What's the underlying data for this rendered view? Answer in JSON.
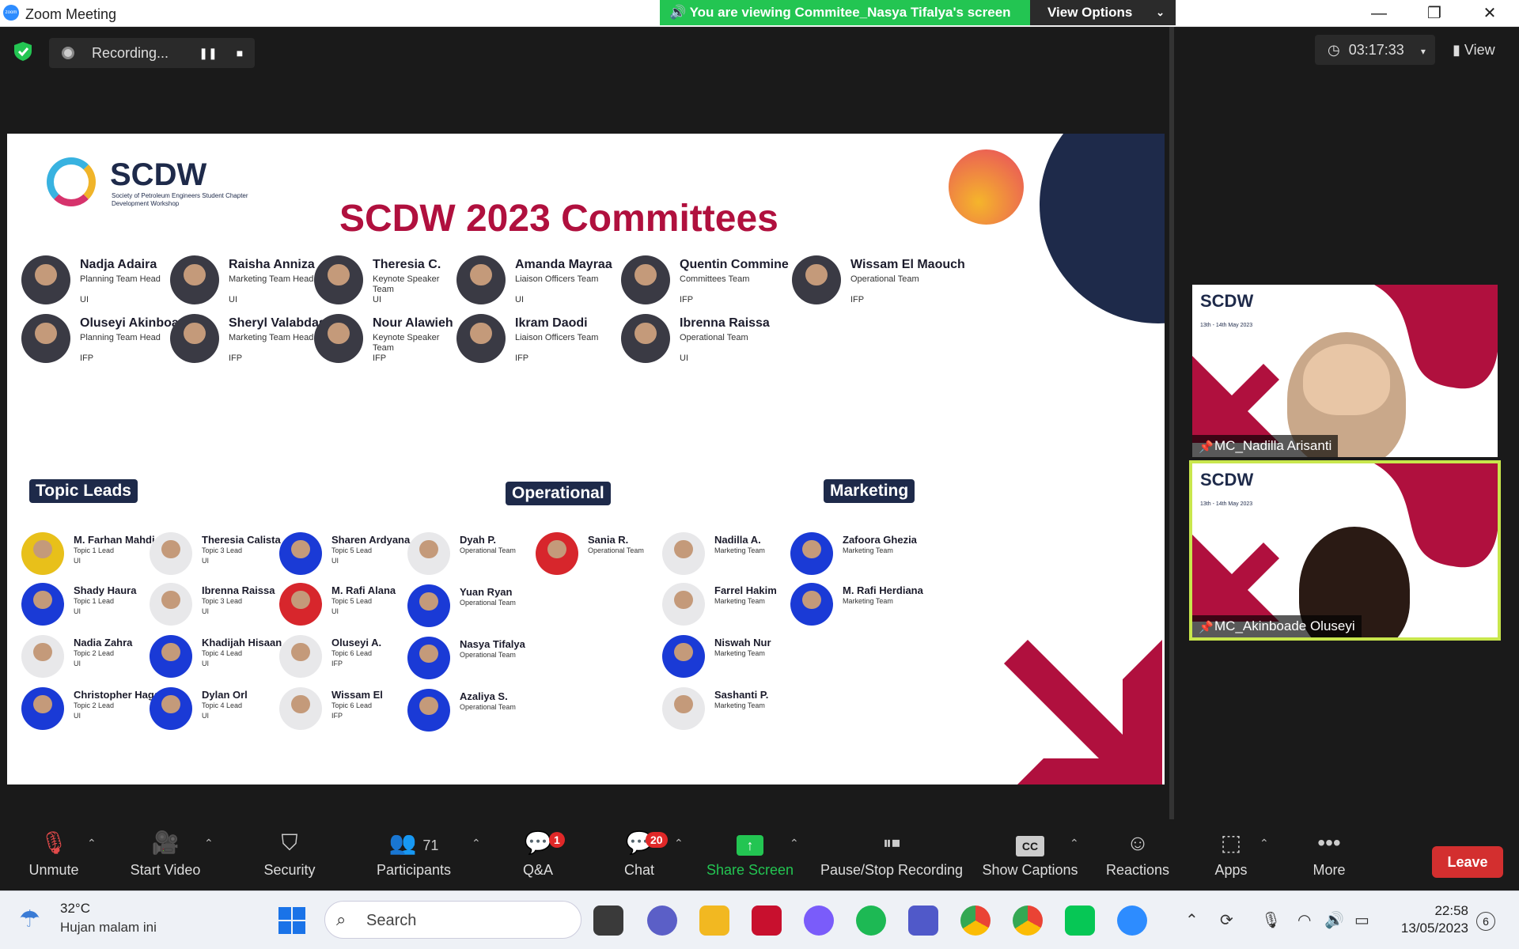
{
  "window": {
    "title": "Zoom Meeting",
    "share_banner": "You are viewing Commitee_Nasya Tifalya's screen",
    "view_options": "View Options",
    "minimize": "—",
    "maximize": "❐",
    "close": "✕"
  },
  "meeting_bar": {
    "recording_label": "Recording...",
    "timer": "03:17:33",
    "view_label": "View"
  },
  "slide": {
    "logo_name": "SCDW",
    "logo_sub": "Society of Petroleum Engineers Student Chapter Development Workshop",
    "title": "SCDW 2023 Committees",
    "heads": [
      {
        "name": "Nadja Adaira",
        "role": "Planning Team Head",
        "org": "UI"
      },
      {
        "name": "Raisha Anniza",
        "role": "Marketing Team Head",
        "org": "UI"
      },
      {
        "name": "Theresia C.",
        "role": "Keynote Speaker Team",
        "org": "UI"
      },
      {
        "name": "Amanda Mayraa",
        "role": "Liaison Officers Team",
        "org": "UI"
      },
      {
        "name": "Quentin Commine",
        "role": "Committees Team",
        "org": "IFP"
      },
      {
        "name": "Wissam El Maouch",
        "role": "Operational Team",
        "org": "IFP"
      },
      {
        "name": "Oluseyi Akinboade",
        "role": "Planning Team Head",
        "org": "IFP"
      },
      {
        "name": "Sheryl Valabdas",
        "role": "Marketing Team Head",
        "org": "IFP"
      },
      {
        "name": "Nour Alawieh",
        "role": "Keynote Speaker Team",
        "org": "IFP"
      },
      {
        "name": "Ikram Daodi",
        "role": "Liaison Officers Team",
        "org": "IFP"
      },
      {
        "name": "Ibrenna Raissa",
        "role": "Operational Team",
        "org": "UI"
      }
    ],
    "sections": {
      "topic_leads": "Topic Leads",
      "operational": "Operational",
      "marketing": "Marketing"
    },
    "topic_leads": [
      {
        "name": "M. Farhan Mahdi",
        "role": "Topic 1 Lead",
        "org": "UI"
      },
      {
        "name": "Theresia Calista",
        "role": "Topic 3 Lead",
        "org": "UI"
      },
      {
        "name": "Sharen Ardyana",
        "role": "Topic 5 Lead",
        "org": "UI"
      },
      {
        "name": "Shady Haura",
        "role": "Topic 1 Lead",
        "org": "UI"
      },
      {
        "name": "Ibrenna Raissa",
        "role": "Topic 3 Lead",
        "org": "UI"
      },
      {
        "name": "M. Rafi Alana",
        "role": "Topic 5 Lead",
        "org": "UI"
      },
      {
        "name": "Nadia Zahra",
        "role": "Topic 2 Lead",
        "org": "UI"
      },
      {
        "name": "Khadijah Hisaan",
        "role": "Topic 4 Lead",
        "org": "UI"
      },
      {
        "name": "Oluseyi A.",
        "role": "Topic 6 Lead",
        "org": "IFP"
      },
      {
        "name": "Christopher Hagan",
        "role": "Topic 2 Lead",
        "org": "UI"
      },
      {
        "name": "Dylan Orl",
        "role": "Topic 4 Lead",
        "org": "UI"
      },
      {
        "name": "Wissam El",
        "role": "Topic 6 Lead",
        "org": "IFP"
      }
    ],
    "operational": [
      {
        "name": "Dyah P.",
        "role": "Operational Team"
      },
      {
        "name": "Sania R.",
        "role": "Operational Team"
      },
      {
        "name": "Yuan Ryan",
        "role": "Operational Team"
      },
      {
        "name": "Nasya Tifalya",
        "role": "Operational Team"
      },
      {
        "name": "Azaliya S.",
        "role": "Operational Team"
      }
    ],
    "marketing": [
      {
        "name": "Nadilla A.",
        "role": "Marketing Team"
      },
      {
        "name": "Zafoora Ghezia",
        "role": "Marketing Team"
      },
      {
        "name": "Farrel Hakim",
        "role": "Marketing Team"
      },
      {
        "name": "M. Rafi Herdiana",
        "role": "Marketing Team"
      },
      {
        "name": "Niswah Nur",
        "role": "Marketing Team"
      },
      {
        "name": "Sashanti P.",
        "role": "Marketing Team"
      }
    ]
  },
  "videos": [
    {
      "name": "MC_Nadilla Arisanti",
      "logo": "SCDW",
      "date": "13th - 14th May 2023"
    },
    {
      "name": "MC_Akinboade Oluseyi",
      "logo": "SCDW",
      "date": "13th - 14th May 2023"
    }
  ],
  "toolbar": {
    "unmute": "Unmute",
    "start_video": "Start Video",
    "security": "Security",
    "participants": "Participants",
    "participants_count": "71",
    "qa": "Q&A",
    "qa_badge": "1",
    "chat": "Chat",
    "chat_badge": "20",
    "share_screen": "Share Screen",
    "recording": "Pause/Stop Recording",
    "captions": "Show Captions",
    "captions_icon": "CC",
    "reactions": "Reactions",
    "apps": "Apps",
    "more": "More",
    "leave": "Leave"
  },
  "taskbar": {
    "temperature": "32°C",
    "weather": "Hujan malam ini",
    "search": "Search",
    "time": "22:58",
    "date": "13/05/2023",
    "notifications": "6"
  },
  "colors": {
    "accent_green": "#23c552",
    "brand_maroon": "#b0103e",
    "navy": "#1e2a4a",
    "leave_red": "#d32f2f"
  }
}
